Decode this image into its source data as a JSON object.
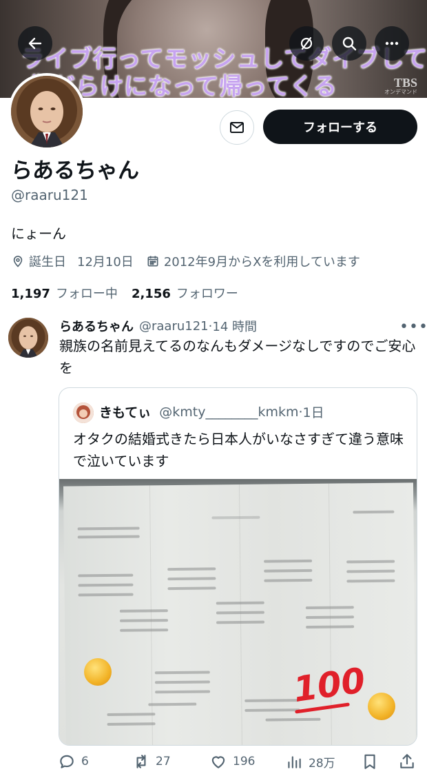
{
  "banner": {
    "caption_line1": "ライブ行ってモッシュしてダイブして",
    "caption_line2": "傷だらけになって帰ってくる",
    "logo_text": "TBS",
    "logo_sub": "オンデマンド"
  },
  "header_buttons": {
    "back": "arrow-left-icon",
    "grok": "grok-icon",
    "search": "search-icon",
    "more": "more-icon"
  },
  "profile": {
    "display_name": "らあるちゃん",
    "handle": "@raaru121",
    "bio": "にょーん",
    "birthday_label": "誕生日",
    "birthday_value": "12月10日",
    "joined": "2012年9月からXを利用しています",
    "following_count": "1,197",
    "following_label": "フォロー中",
    "followers_count": "2,156",
    "followers_label": "フォロワー",
    "follow_button": "フォローする"
  },
  "tweet": {
    "author_name": "らあるちゃん",
    "author_handle": "@raaru121",
    "time": "14 時間",
    "text": "親族の名前見えてるのなんもダメージなしですのでご安心を",
    "quote": {
      "author_name": "きもてぃ",
      "author_handle": "@kmty________kmkm",
      "time": "1日",
      "text": "オタクの結婚式きたら日本人がいなさすぎて違う意味で泣いています",
      "photo_sticker": "100"
    },
    "actions": {
      "replies": "6",
      "reposts": "27",
      "likes": "196",
      "views": "28万"
    }
  },
  "colors": {
    "text": "#0f1419",
    "secondary": "#536471",
    "border": "#cfd9de",
    "follow_bg": "#0f1419"
  }
}
